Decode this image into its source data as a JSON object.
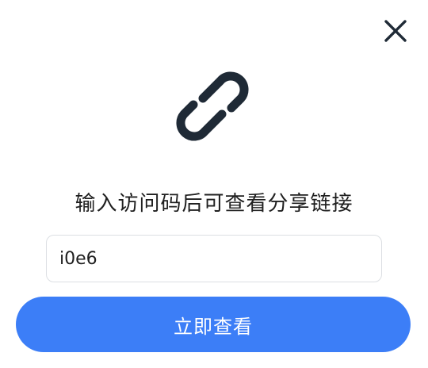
{
  "dialog": {
    "close_icon": "close-icon",
    "link_icon": "link-icon",
    "prompt": "输入访问码后可查看分享链接",
    "access_code_value": "i0e6",
    "submit_label": "立即查看"
  },
  "colors": {
    "accent": "#3c7ef7",
    "icon": "#1f2a36",
    "text": "#1f1f1f",
    "input_border": "#dcdfe3"
  }
}
